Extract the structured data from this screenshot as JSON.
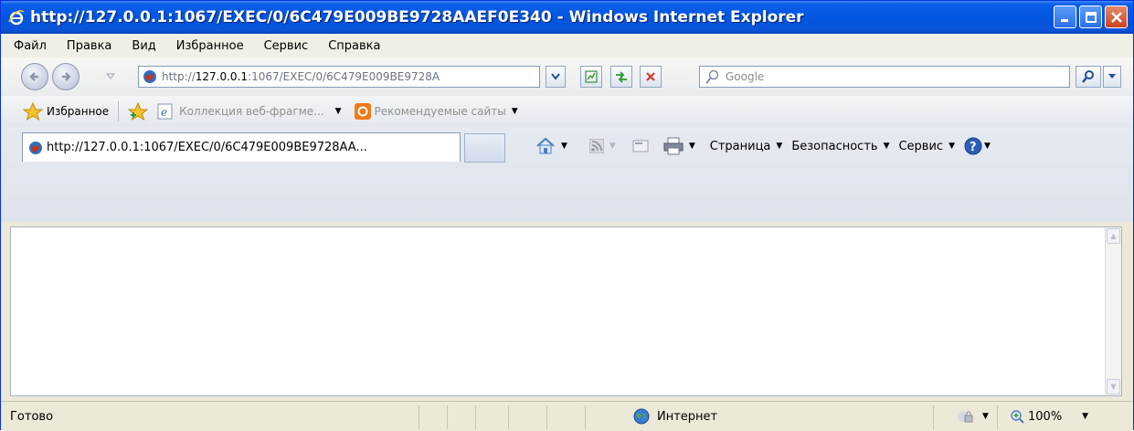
{
  "window": {
    "title": "http://127.0.0.1:1067/EXEC/0/6C479E009BE9728AAEF0E340 - Windows Internet Explorer"
  },
  "menu": [
    "Файл",
    "Правка",
    "Вид",
    "Избранное",
    "Сервис",
    "Справка"
  ],
  "address": {
    "prefix": "http://",
    "host": "127.0.0.1",
    "rest": ":1067/EXEC/0/6C479E009BE9728A"
  },
  "search": {
    "placeholder": "Google"
  },
  "favorites": {
    "label": "Избранное",
    "web_slices": "Коллекция веб-фрагме...",
    "suggested": "Рекомендуемые сайты"
  },
  "tab": {
    "label": "http://127.0.0.1:1067/EXEC/0/6C479E009BE9728AA..."
  },
  "commands": {
    "page": "Страница",
    "safety": "Безопасность",
    "tools": "Сервис"
  },
  "status": {
    "text": "Готово",
    "zone": "Интернет",
    "zoom": "100%"
  },
  "colors": {
    "titlebar": "#0256e0",
    "close": "#c9421e"
  }
}
